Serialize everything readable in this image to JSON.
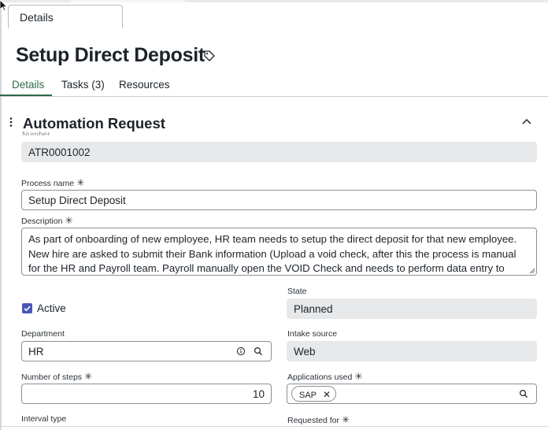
{
  "window_tab": {
    "label": "Details"
  },
  "record": {
    "title": "Setup Direct Deposit",
    "title_icon": "tag-icon"
  },
  "tabs": [
    {
      "label": "Details",
      "active": true
    },
    {
      "label": "Tasks (3)",
      "active": false
    },
    {
      "label": "Resources",
      "active": false
    }
  ],
  "section": {
    "title": "Automation Request",
    "collapse_icon": "chevron-up-icon",
    "drag_icon": "drag-handle-icon"
  },
  "fields": {
    "number": {
      "label": "Number",
      "value": "ATR0001002"
    },
    "process_name": {
      "label": "Process name",
      "required": "✳",
      "value": "Setup Direct Deposit"
    },
    "description": {
      "label": "Description",
      "required": "✳",
      "value": "As part of onboarding of new employee, HR team needs to setup the direct deposit for that new employee. New hire are asked to submit their Bank information (Upload a void check, after this the process is manual for the HR and Payroll team. Payroll manually open the VOID Check and needs to perform data entry to store the Banking Info in Service Now and any additional data verification is done which result in more total days. Once the Banking"
    },
    "active": {
      "label": "Active",
      "checked": true
    },
    "state": {
      "label": "State",
      "value": "Planned"
    },
    "department": {
      "label": "Department",
      "value": "HR",
      "info_icon": "info-icon",
      "search_icon": "search-icon"
    },
    "intake_source": {
      "label": "Intake source",
      "value": "Web"
    },
    "number_of_steps": {
      "label": "Number of steps",
      "required": "✳",
      "value": "10"
    },
    "applications_used": {
      "label": "Applications used",
      "required": "✳",
      "chips": [
        "SAP"
      ],
      "search_icon": "search-icon"
    },
    "interval_type": {
      "label": "Interval type"
    },
    "requested_for": {
      "label": "Requested for",
      "required": "✳"
    }
  },
  "colors": {
    "accent": "#2c6a4a",
    "checkbox": "#4a57b8",
    "readonly_bg": "#e6e8ea"
  }
}
